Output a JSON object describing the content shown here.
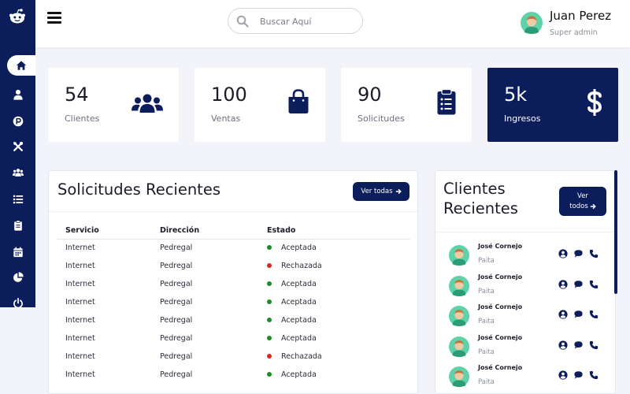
{
  "topbar": {
    "search_placeholder": "Buscar Aquí",
    "user_name": "Juan Perez",
    "user_role": "Super admin"
  },
  "sidebar": {
    "items": [
      {
        "icon": "home-icon",
        "active": true
      },
      {
        "icon": "user-icon"
      },
      {
        "icon": "parking-icon"
      },
      {
        "icon": "tools-icon"
      },
      {
        "icon": "users-icon"
      },
      {
        "icon": "list-icon"
      },
      {
        "icon": "clipboard-icon"
      },
      {
        "icon": "calendar-icon"
      },
      {
        "icon": "pie-chart-icon"
      },
      {
        "icon": "power-icon"
      }
    ]
  },
  "stats": [
    {
      "value": "54",
      "label": "Clientes",
      "icon": "users-icon"
    },
    {
      "value": "100",
      "label": "Ventas",
      "icon": "shopping-bag-icon"
    },
    {
      "value": "90",
      "label": "Solicitudes",
      "icon": "clipboard-list-icon"
    },
    {
      "value": "5k",
      "label": "Ingresos",
      "icon": "dollar-icon"
    }
  ],
  "requests": {
    "title": "Solicitudes Recientes",
    "button": "Ver todas",
    "columns": [
      "Servicio",
      "Dirección",
      "Estado"
    ],
    "rows": [
      {
        "servicio": "Internet",
        "direccion": "Pedregal",
        "estado": "Aceptada",
        "status": "ok"
      },
      {
        "servicio": "Internet",
        "direccion": "Pedregal",
        "estado": "Rechazada",
        "status": "no"
      },
      {
        "servicio": "Internet",
        "direccion": "Pedregal",
        "estado": "Aceptada",
        "status": "ok"
      },
      {
        "servicio": "Internet",
        "direccion": "Pedregal",
        "estado": "Aceptada",
        "status": "ok"
      },
      {
        "servicio": "Internet",
        "direccion": "Pedregal",
        "estado": "Aceptada",
        "status": "ok"
      },
      {
        "servicio": "Internet",
        "direccion": "Pedregal",
        "estado": "Aceptada",
        "status": "ok"
      },
      {
        "servicio": "Internet",
        "direccion": "Pedregal",
        "estado": "Rechazada",
        "status": "no"
      },
      {
        "servicio": "Internet",
        "direccion": "Pedregal",
        "estado": "Aceptada",
        "status": "ok"
      }
    ]
  },
  "clients": {
    "title_line1": "Clientes",
    "title_line2": "Recientes",
    "button_line1": "Ver",
    "button_line2": "todos",
    "items": [
      {
        "name": "José Cornejo",
        "city": "Paita"
      },
      {
        "name": "José Cornejo",
        "city": "Paita"
      },
      {
        "name": "José Cornejo",
        "city": "Paita"
      },
      {
        "name": "José Cornejo",
        "city": "Paita"
      },
      {
        "name": "José Cornejo",
        "city": "Paita"
      }
    ]
  },
  "colors": {
    "navy": "#0b1d5a",
    "accepted": "#1f8a2a",
    "rejected": "#d62828",
    "background": "#f2f4f9"
  }
}
